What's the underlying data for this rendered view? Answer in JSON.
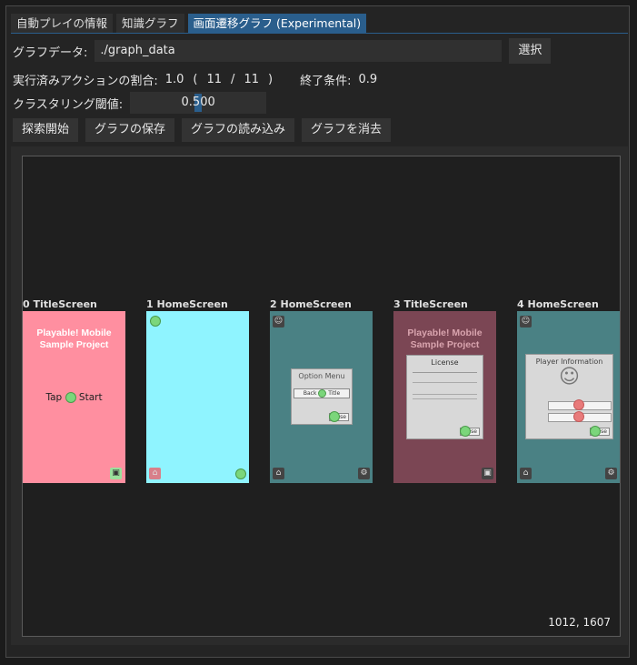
{
  "tabs": [
    "自動プレイの情報",
    "知識グラフ",
    "画面遷移グラフ (Experimental)"
  ],
  "graph_data": {
    "label": "グラフデータ:",
    "value": "./graph_data",
    "select_button": "選択"
  },
  "actions": {
    "label": "実行済みアクションの割合:",
    "ratio": "1.0",
    "open": "(",
    "done": "11",
    "slash": "/",
    "total": "11",
    "close": ")"
  },
  "end_condition": {
    "label": "終了条件:",
    "value": "0.9"
  },
  "clustering": {
    "label": "クラスタリング閾値:",
    "value": "0.500"
  },
  "buttons": {
    "explore": "探索開始",
    "save": "グラフの保存",
    "load": "グラフの読み込み",
    "clear": "グラフを消去"
  },
  "nodes": [
    {
      "label": "0 TitleScreen",
      "bg": "#ff8fa0",
      "title": "Playable! Mobile Sample Project",
      "tap_pre": "Tap",
      "tap_post": "Start"
    },
    {
      "label": "1 HomeScreen",
      "bg": "#8ff4ff"
    },
    {
      "label": "2 HomeScreen",
      "bg": "#4a8184",
      "dialog_title": "Option Menu",
      "dialog_btn_pre": "Back",
      "dialog_btn_post": "Title",
      "close": "Close"
    },
    {
      "label": "3 TitleScreen",
      "bg": "#7b4654",
      "title": "Playable! Mobile Sample Project",
      "dialog_title": "License",
      "close": "Close"
    },
    {
      "label": "4 HomeScreen",
      "bg": "#4a8184",
      "dialog_title": "Player Information",
      "close": "Close"
    }
  ],
  "coords": "1012, 1607",
  "colors": {
    "accent": "#2a5e8c",
    "background": "#242424"
  }
}
